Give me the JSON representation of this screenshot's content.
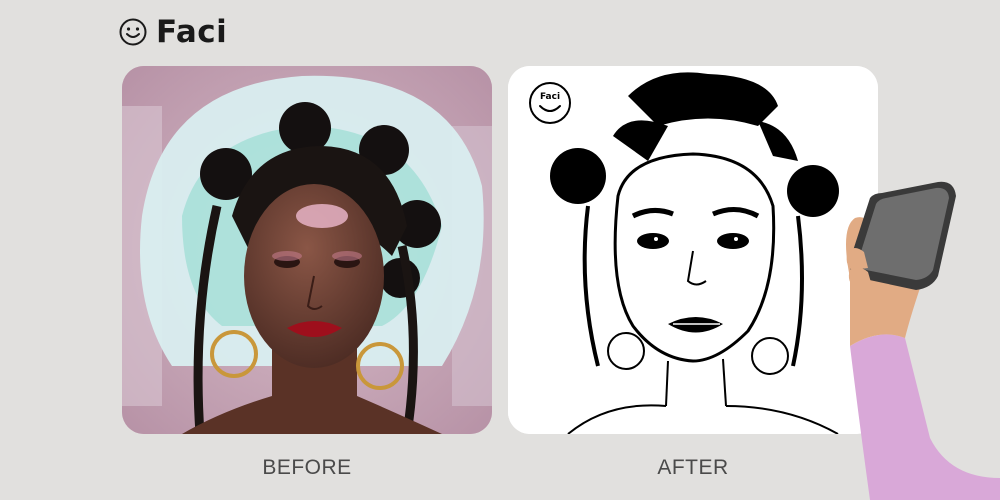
{
  "brand": {
    "name": "Faci",
    "icon": "smiley-face-icon"
  },
  "before": {
    "caption": "BEFORE",
    "image": "portrait-photo"
  },
  "after": {
    "caption": "AFTER",
    "image": "sketch-portrait",
    "watermark": "Faci",
    "watermark_icon": "faci-circle-logo-icon"
  },
  "decoration": {
    "image": "hand-holding-phone"
  },
  "colors": {
    "background": "#e1e0de",
    "text_dark": "#1a1a1a",
    "caption": "#4a4a4a",
    "card_after": "#ffffff",
    "sleeve": "#d9a8d8",
    "skin": "#e1ab84"
  }
}
